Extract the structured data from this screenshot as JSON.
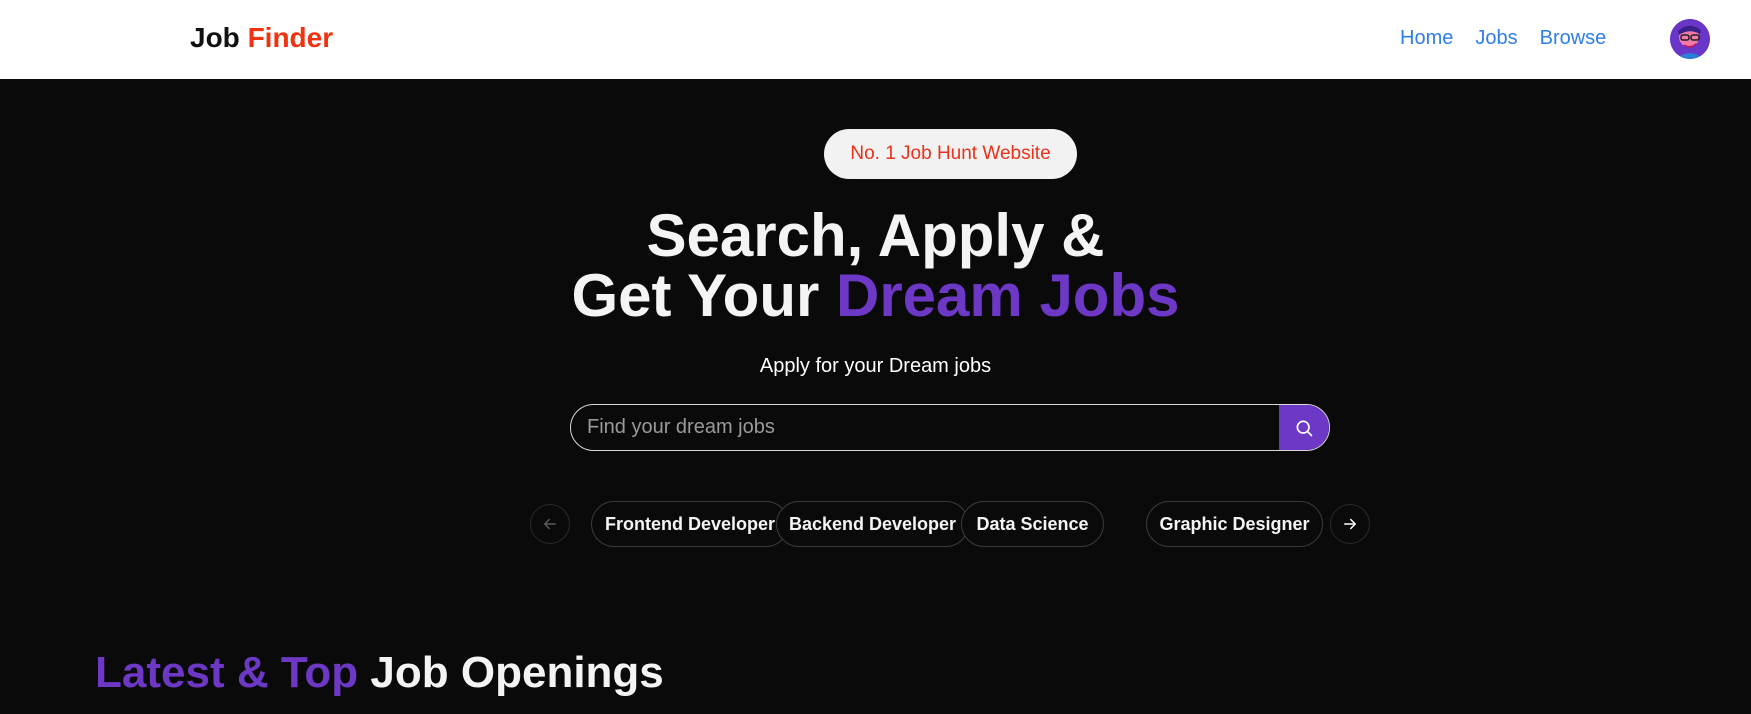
{
  "navbar": {
    "logo_part1": "Job",
    "logo_part2": "Finder",
    "links": [
      "Home",
      "Jobs",
      "Browse"
    ]
  },
  "hero": {
    "badge": "No. 1 Job Hunt Website",
    "headline_line1": "Search, Apply &",
    "headline_line2_white": "Get Your",
    "headline_line2_purple": "Dream Jobs",
    "subtitle": "Apply for your Dream jobs",
    "search_placeholder": "Find your dream jobs"
  },
  "categories": [
    "Frontend Developer",
    "Backend Developer",
    "Data Science",
    "Graphic Designer"
  ],
  "latest": {
    "title_purple": "Latest & Top",
    "title_white": "Job Openings"
  },
  "colors": {
    "accent_purple": "#6d38c6",
    "accent_red": "#f0320f",
    "link_blue": "#2f7ee8",
    "background": "#0b0a0b"
  },
  "icons": {
    "search": "search-icon",
    "prev": "arrow-left-icon",
    "next": "arrow-right-icon"
  }
}
